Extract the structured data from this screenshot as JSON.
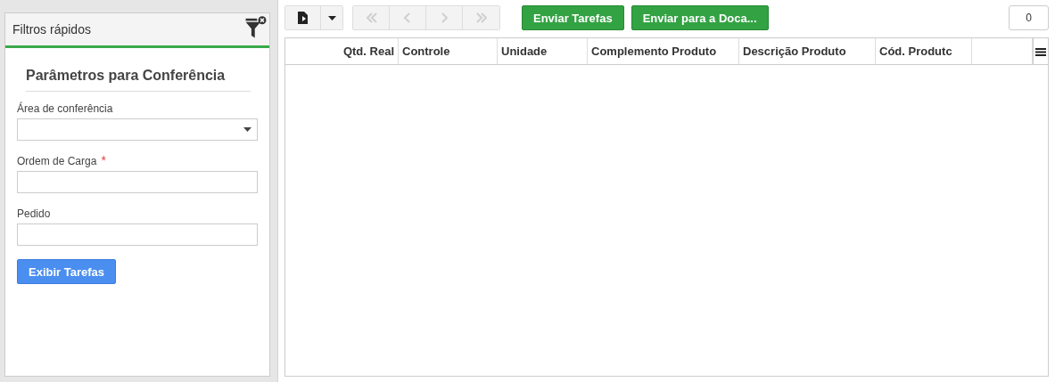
{
  "filter_panel": {
    "title": "Filtros rápidos",
    "section_title": "Parâmetros para Conferência",
    "fields": [
      {
        "label": "Área de conferência",
        "kind": "select"
      },
      {
        "label": "Ordem de Carga",
        "kind": "text",
        "required_mark": "*"
      },
      {
        "label": "Pedido",
        "kind": "text"
      }
    ],
    "submit_button": "Exibir Tarefas"
  },
  "toolbar": {
    "pager": [
      {
        "kind": "first",
        "disabled": true
      },
      {
        "kind": "prev",
        "disabled": true
      },
      {
        "kind": "next",
        "disabled": true
      },
      {
        "kind": "last",
        "disabled": true
      }
    ],
    "actions": [
      "Enviar Tarefas",
      "Enviar para a Doca..."
    ],
    "count": "0"
  },
  "table": {
    "columns": [
      "Qtd. Real",
      "Controle",
      "Unidade",
      "Complemento Produto",
      "Descrição Produto",
      "Cód. Produtc"
    ]
  }
}
